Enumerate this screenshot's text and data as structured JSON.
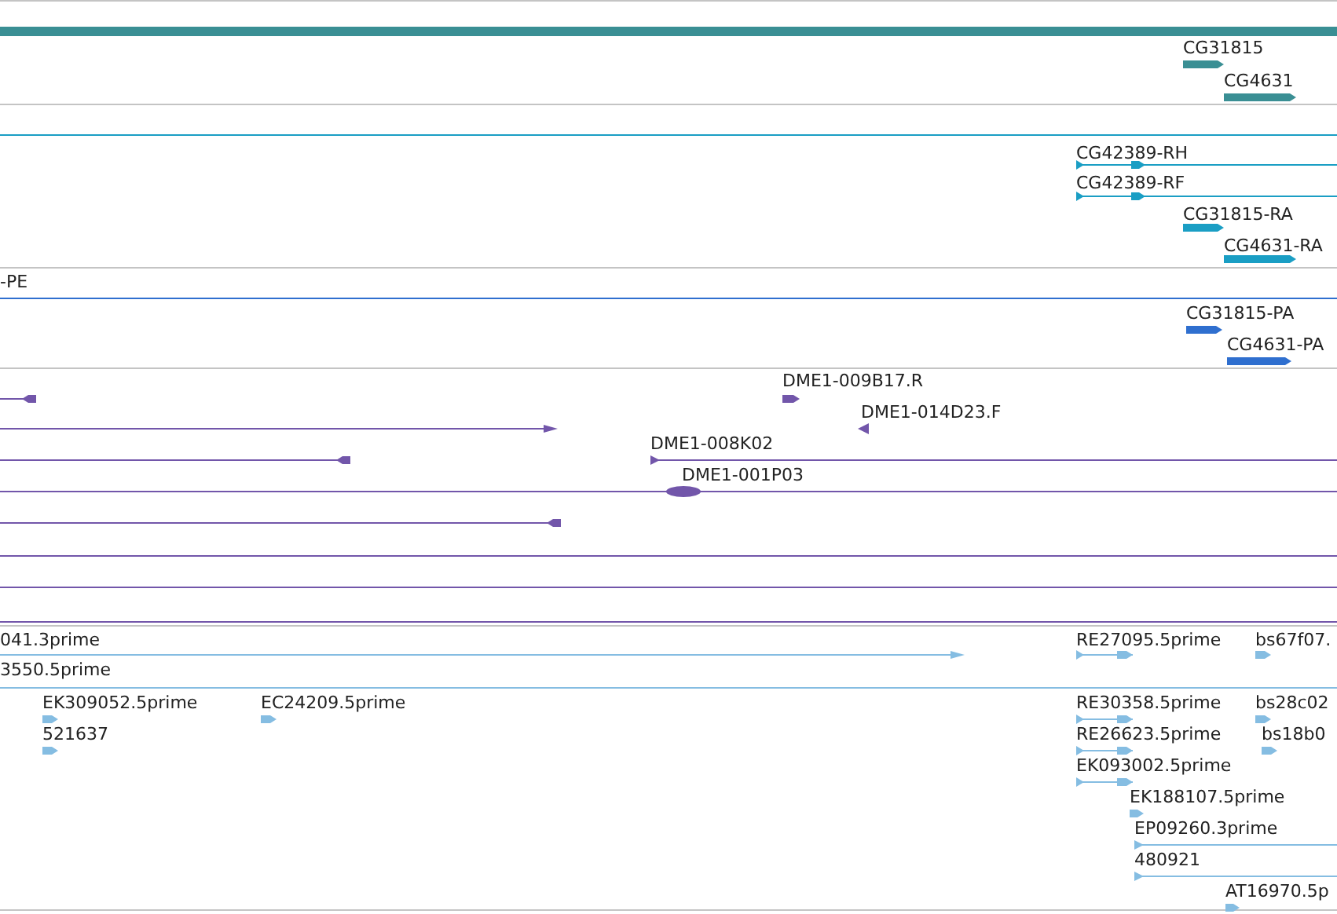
{
  "tracks": [
    {
      "color": "#3a8f94",
      "features": [
        {
          "kind": "thick"
        },
        {
          "kind": "bar",
          "label": "CG31815"
        },
        {
          "kind": "bar",
          "label": "CG4631"
        }
      ]
    },
    {
      "color": "#1a9ec4",
      "features": [
        {
          "kind": "line"
        },
        {
          "kind": "transcript",
          "label": "CG42389-RH"
        },
        {
          "kind": "transcript",
          "label": "CG42389-RF"
        },
        {
          "kind": "bar",
          "label": "CG31815-RA"
        },
        {
          "kind": "bar",
          "label": "CG4631-RA"
        }
      ]
    },
    {
      "color": "#2f6fcf",
      "features": [
        {
          "kind": "label",
          "label": "-PE"
        },
        {
          "kind": "line"
        },
        {
          "kind": "bar",
          "label": "CG31815-PA"
        },
        {
          "kind": "bar",
          "label": "CG4631-PA"
        }
      ]
    },
    {
      "color": "#7256aa",
      "features": [
        {
          "kind": "line_block"
        },
        {
          "kind": "bar",
          "label": "DME1-009B17.R"
        },
        {
          "kind": "line_arrow"
        },
        {
          "kind": "tri_left",
          "label": "DME1-014D23.F"
        },
        {
          "kind": "line_block"
        },
        {
          "kind": "start_line",
          "label": "DME1-008K02"
        },
        {
          "kind": "line"
        },
        {
          "kind": "oval",
          "label": "DME1-001P03"
        },
        {
          "kind": "line_block"
        },
        {
          "kind": "line"
        },
        {
          "kind": "line"
        },
        {
          "kind": "line"
        }
      ]
    },
    {
      "color": "#85bde2",
      "features": [
        {
          "kind": "line_arrow",
          "label": "041.3prime"
        },
        {
          "kind": "span",
          "label": "RE27095.5prime"
        },
        {
          "kind": "bar",
          "label": "bs67f07."
        },
        {
          "kind": "line",
          "label": "3550.5prime"
        },
        {
          "kind": "bar",
          "label": "EK309052.5prime"
        },
        {
          "kind": "bar",
          "label": "521637"
        },
        {
          "kind": "bar",
          "label": "EC24209.5prime"
        },
        {
          "kind": "span",
          "label": "RE30358.5prime"
        },
        {
          "kind": "bar",
          "label": "bs28c02"
        },
        {
          "kind": "span",
          "label": "RE26623.5prime"
        },
        {
          "kind": "bar",
          "label": "bs18b0"
        },
        {
          "kind": "span",
          "label": "EK093002.5prime"
        },
        {
          "kind": "bar",
          "label": "EK188107.5prime"
        },
        {
          "kind": "start_line",
          "label": "EP09260.3prime"
        },
        {
          "kind": "start_line",
          "label": "480921"
        },
        {
          "kind": "bar",
          "label": "AT16970.5p"
        }
      ]
    }
  ]
}
